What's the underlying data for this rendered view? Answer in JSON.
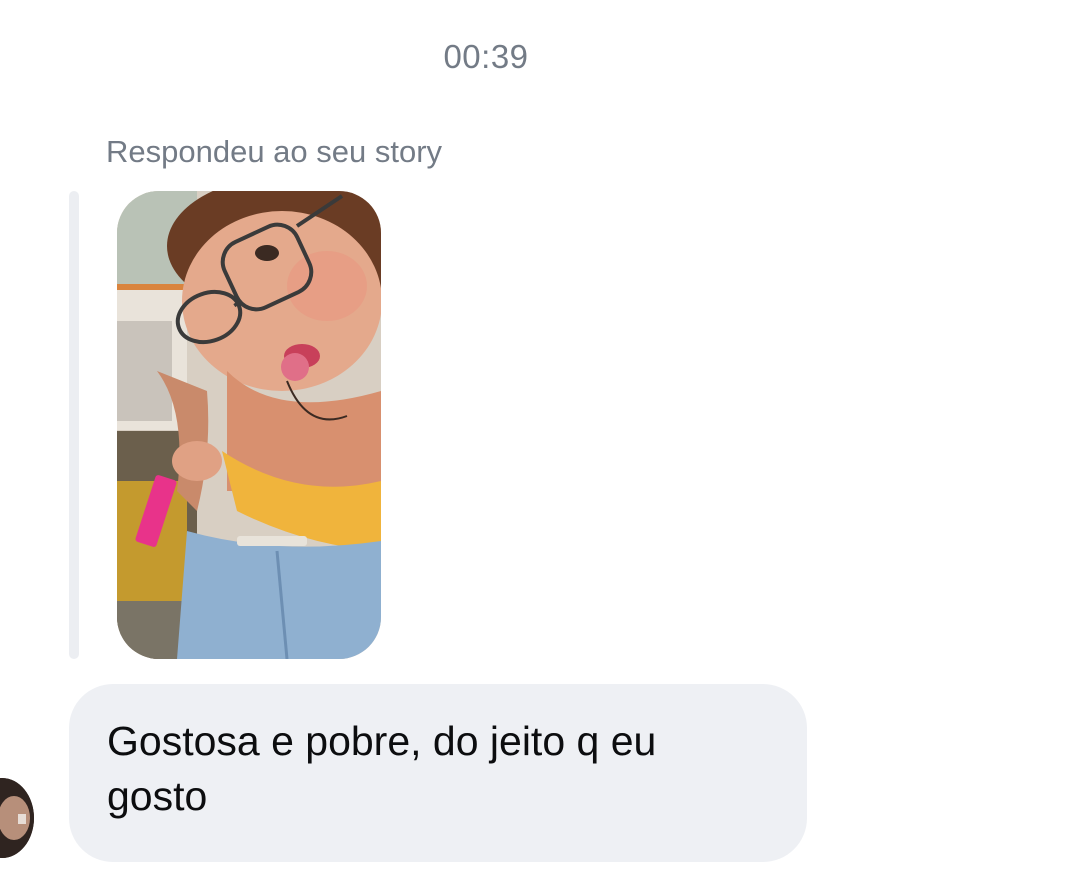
{
  "conversation": {
    "timestamp": "00:39",
    "reply_context": "Respondeu ao seu story",
    "message": {
      "text": "Gostosa e pobre, do jeito q eu gosto"
    }
  }
}
